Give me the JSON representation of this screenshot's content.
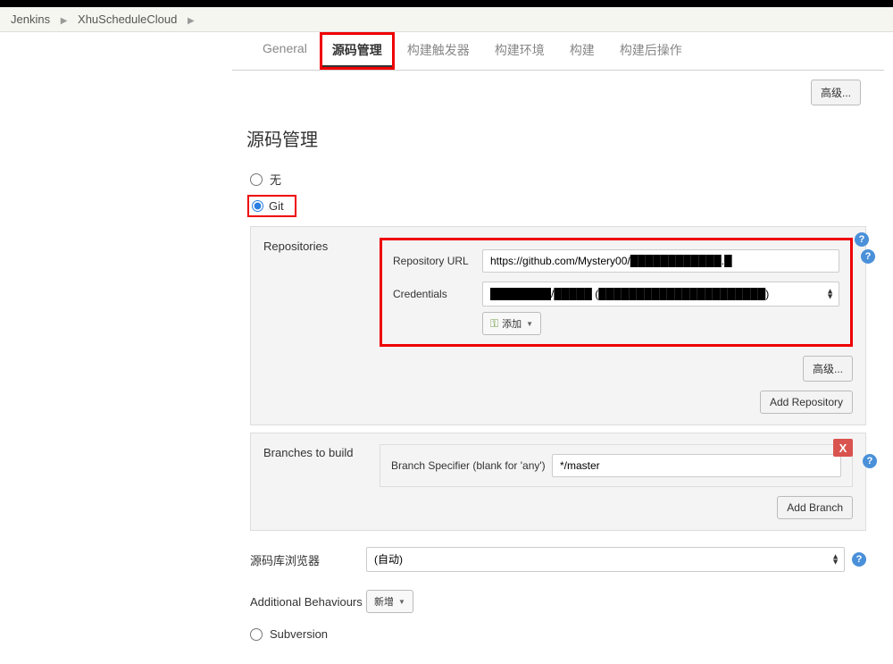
{
  "breadcrumb": {
    "jenkins": "Jenkins",
    "project": "XhuScheduleCloud"
  },
  "tabs": {
    "general": "General",
    "scm": "源码管理",
    "triggers": "构建触发器",
    "env": "构建环境",
    "build": "构建",
    "post": "构建后操作"
  },
  "buttons": {
    "advanced": "高级...",
    "add_repo": "Add Repository",
    "add_branch": "Add Branch",
    "add_credential": "添加",
    "new_behaviour": "新增"
  },
  "section": {
    "title": "源码管理"
  },
  "radios": {
    "none": "无",
    "git": "Git",
    "subversion": "Subversion"
  },
  "repositories": {
    "label": "Repositories",
    "url_label": "Repository URL",
    "url_value": "https://github.com/Mystery00/████████████.█",
    "cred_label": "Credentials",
    "cred_value": "████████/█████ (██████████████████████)"
  },
  "branches": {
    "label": "Branches to build",
    "spec_label": "Branch Specifier (blank for 'any')",
    "spec_value": "*/master"
  },
  "browser": {
    "label": "源码库浏览器",
    "value": "(自动)"
  },
  "behaviours": {
    "label": "Additional Behaviours"
  },
  "icons": {
    "delete": "X"
  }
}
